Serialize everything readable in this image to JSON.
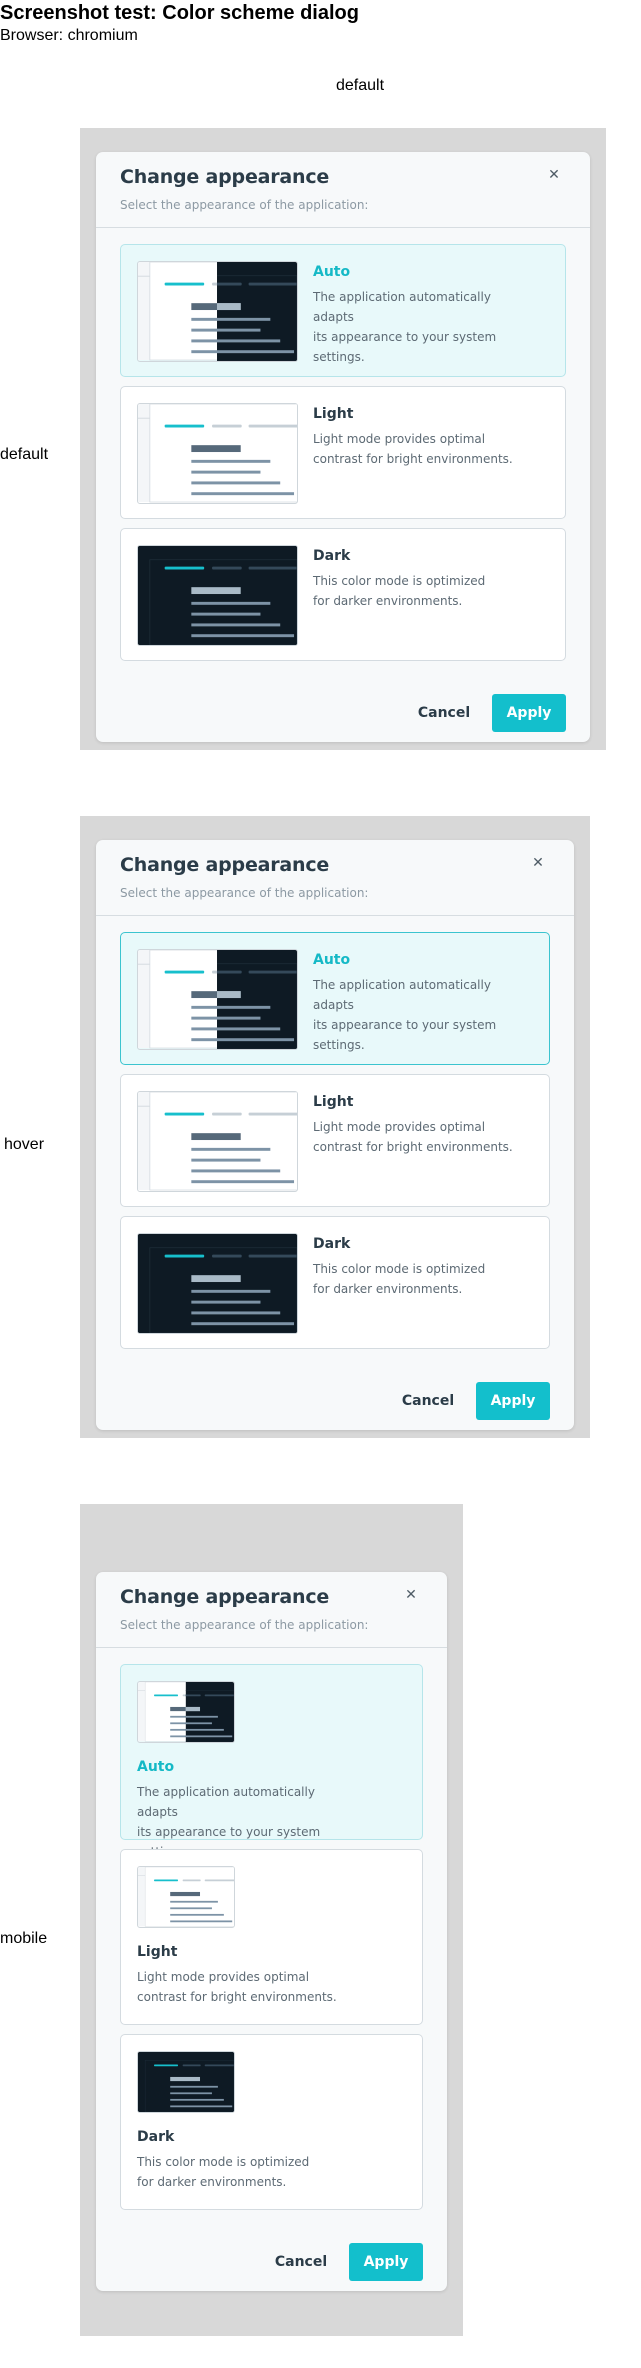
{
  "page": {
    "title": "Screenshot test: Color scheme dialog",
    "browser": "Browser: chromium",
    "column_header": "default",
    "rows": [
      "default",
      "hover",
      "mobile"
    ]
  },
  "dialog": {
    "title": "Change appearance",
    "description": "Select the appearance of the application:",
    "close_icon": "close-icon",
    "options": [
      {
        "id": "auto",
        "title": "Auto",
        "description": "The application automatically adapts\nits appearance to your system settings."
      },
      {
        "id": "light",
        "title": "Light",
        "description": "Light mode provides optimal\ncontrast for bright environments."
      },
      {
        "id": "dark",
        "title": "Dark",
        "description": "This color mode is optimized\nfor darker environments."
      }
    ],
    "cancel_label": "Cancel",
    "apply_label": "Apply"
  },
  "colors": {
    "accent": "#13bfcc",
    "selected_bg": "#e8f9fa",
    "hover_border": "#3bc4cf",
    "frame_bg": "#d8d8d8",
    "dark_bg": "#0e1a24"
  }
}
